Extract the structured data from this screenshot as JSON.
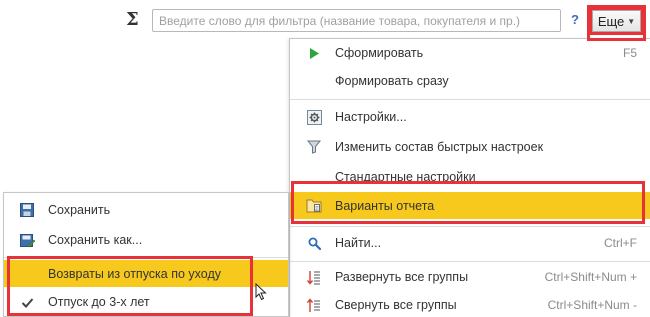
{
  "toolbar": {
    "sigma": "Σ",
    "filter_placeholder": "Введите слово для фильтра (название товара, покупателя и пр.)",
    "help": "?",
    "more_label": "Еще"
  },
  "menu": {
    "items": [
      {
        "label": "Сформировать",
        "shortcut": "F5",
        "icon": "play-icon"
      },
      {
        "label": "Формировать сразу",
        "shortcut": "",
        "icon": ""
      },
      {
        "label": "Настройки...",
        "shortcut": "",
        "icon": "settings-icon"
      },
      {
        "label": "Изменить состав быстрых настроек",
        "shortcut": "",
        "icon": "filter-icon"
      },
      {
        "label": "Стандартные настройки",
        "shortcut": "",
        "icon": ""
      },
      {
        "label": "Варианты отчета",
        "shortcut": "",
        "icon": "report-variants-icon"
      },
      {
        "label": "Найти...",
        "shortcut": "Ctrl+F",
        "icon": "search-icon"
      },
      {
        "label": "Развернуть все группы",
        "shortcut": "Ctrl+Shift+Num +",
        "icon": "expand-groups-icon"
      },
      {
        "label": "Свернуть все группы",
        "shortcut": "Ctrl+Shift+Num -",
        "icon": "collapse-groups-icon"
      }
    ]
  },
  "variants_menu": {
    "items": [
      {
        "label": "Сохранить",
        "icon": "save-icon"
      },
      {
        "label": "Сохранить как...",
        "icon": "save-as-icon"
      },
      {
        "label": "Возвраты из отпуска по уходу",
        "icon": ""
      },
      {
        "label": "Отпуск до 3-х лет",
        "icon": "check-icon"
      }
    ]
  },
  "colors": {
    "highlight": "#f7c91c",
    "annotation_border": "#e8323a",
    "play_green": "#2ea43a",
    "help_blue": "#3a6fb8"
  }
}
